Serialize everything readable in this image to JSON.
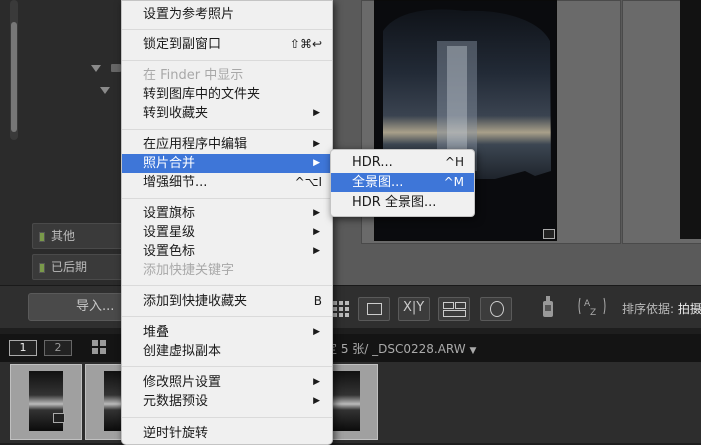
{
  "left_panel": {
    "collections": [
      {
        "label": "其他"
      },
      {
        "label": "已后期"
      }
    ]
  },
  "toolbar": {
    "import_label": "导入...",
    "sort_label": "排序依据:",
    "sort_value": "拍摄"
  },
  "filmstrip_bar": {
    "page_1": "1",
    "page_2": "2",
    "info": "定 5 张/ _DSC0228.ARW"
  },
  "context_menu": {
    "items": [
      {
        "label": "设置为参考照片"
      },
      {
        "label": "锁定到副窗口",
        "shortcut": "⇧⌘↩"
      },
      {
        "label": "在 Finder 中显示",
        "disabled": true
      },
      {
        "label": "转到图库中的文件夹"
      },
      {
        "label": "转到收藏夹"
      },
      {
        "label": "在应用程序中编辑"
      },
      {
        "label": "照片合并",
        "highlighted": true
      },
      {
        "label": "增强细节...",
        "shortcut": "^⌥I"
      },
      {
        "label": "设置旗标"
      },
      {
        "label": "设置星级"
      },
      {
        "label": "设置色标"
      },
      {
        "label": "添加快捷关键字",
        "disabled": true
      },
      {
        "label": "添加到快捷收藏夹",
        "shortcut": "B"
      },
      {
        "label": "堆叠"
      },
      {
        "label": "创建虚拟副本"
      },
      {
        "label": "修改照片设置"
      },
      {
        "label": "元数据预设"
      },
      {
        "label": "逆时针旋转"
      }
    ]
  },
  "submenu": {
    "items": [
      {
        "label": "HDR...",
        "shortcut": "^H"
      },
      {
        "label": "全景图...",
        "shortcut": "^M",
        "highlighted": true
      },
      {
        "label": "HDR 全景图..."
      }
    ]
  }
}
